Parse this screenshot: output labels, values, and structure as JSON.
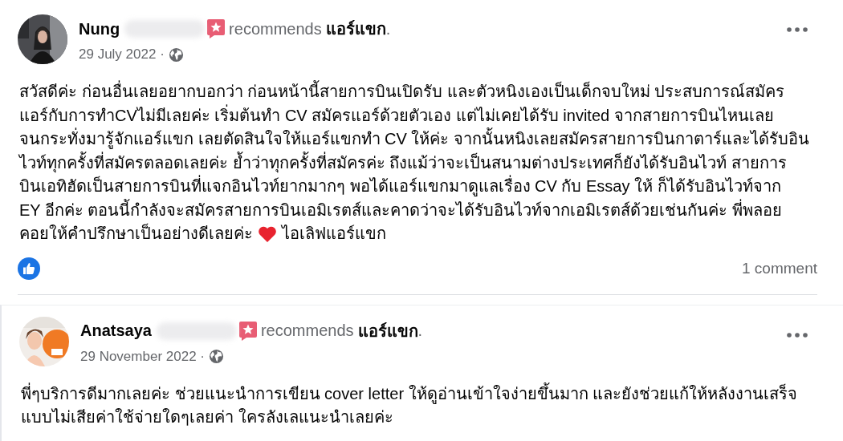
{
  "posts": [
    {
      "author": "Nung",
      "action": "recommends",
      "page": "แอร์แขก",
      "page_suffix": ".",
      "date": "29 July 2022 ·",
      "lines": [
        {
          "text": "สวัสดีค่ะ ก่อนอื่นเลยอยากบอกว่า ก่อนหน้านี้สายการบินเปิดรับ และตัวหนิงเองเป็นเด็กจบใหม่ ประสบการณ์สมัคร"
        },
        {
          "text": "แอร์กับการทำCVไม่มีเลยค่ะ เริ่มต้นทำ CV สมัครแอร์ด้วยตัวเอง แต่ไม่เคยได้รับ invited จากสายการบินไหนเลย"
        },
        {
          "text": "จนกระทั่งมารู้จักแอร์แขก เลยตัดสินใจให้แอร์แขกทำ CV ให้ค่ะ จากนั้นหนิงเลยสมัครสายการบินกาตาร์และได้รับอิน"
        },
        {
          "text": "ไวท์ทุกครั้งที่สมัครตลอดเลยค่ะ ย้ำว่าทุกครั้งที่สมัครค่ะ ถึงแม้ว่าจะเป็นสนามต่างประเทศก็ยังได้รับอินไวท์ สายการ"
        },
        {
          "text": "บินเอทิฮัดเป็นสายการบินที่แจกอินไวท์ยากมากๆ พอได้แอร์แขกมาดูแลเรื่อง CV กับ Essay ให้ ก็ได้รับอินไวท์จาก"
        },
        {
          "text": "EY อีกค่ะ ตอนนี้กำลังจะสมัครสายการบินเอมิเรตส์และคาดว่าจะได้รับอินไวท์จากเอมิเรตส์ด้วยเช่นกันค่ะ พี่พลอย"
        },
        {
          "text": "คอยให้คำปรึกษาเป็นอย่างดีเลยค่ะ",
          "heart": true,
          "after": "ไอเลิฟแอร์แขก"
        }
      ],
      "comments": "1 comment"
    },
    {
      "author": "Anatsaya",
      "action": "recommends",
      "page": "แอร์แขก",
      "page_suffix": ".",
      "date": "29 November 2022 ·",
      "lines": [
        {
          "text": "พี่ๆบริการดีมากเลยค่ะ ช่วยแนะนำการเขียน cover letter ให้ดูอ่านเข้าใจง่ายขึ้นมาก และยังช่วยแก้ให้หลังงานเสร็จ"
        },
        {
          "text": "แบบไม่เสียค่าใช้จ่ายใดๆเลยค่า ใครลังเลแนะนำเลยค่ะ"
        }
      ]
    }
  ]
}
